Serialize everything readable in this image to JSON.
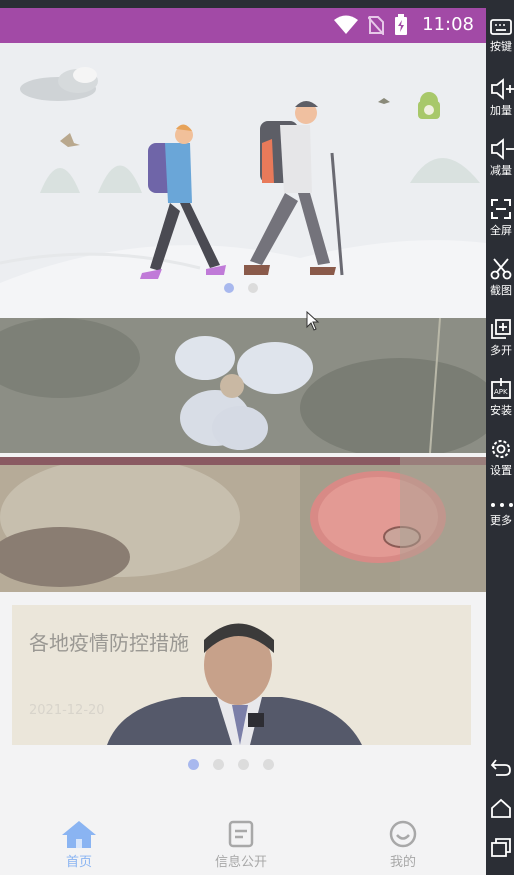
{
  "status_bar": {
    "time": "11:08",
    "color": "#a24aa6"
  },
  "hero_carousel": {
    "pages": 2,
    "active_index": 0
  },
  "news_card": {
    "title": "各地疫情防控措施",
    "date": "2021-12-20"
  },
  "news_carousel": {
    "pages": 4,
    "active_index": 0
  },
  "tabs": [
    {
      "label": "首页",
      "icon": "home-icon",
      "active": true
    },
    {
      "label": "信息公开",
      "icon": "document-icon",
      "active": false
    },
    {
      "label": "我的",
      "icon": "smiley-icon",
      "active": false
    }
  ],
  "sidebar": {
    "items": [
      {
        "label": "按键",
        "icon": "keyboard-icon"
      },
      {
        "label": "加量",
        "icon": "volume-up-icon"
      },
      {
        "label": "减量",
        "icon": "volume-down-icon"
      },
      {
        "label": "全屏",
        "icon": "fullscreen-icon"
      },
      {
        "label": "截图",
        "icon": "scissors-icon"
      },
      {
        "label": "多开",
        "icon": "multi-open-icon"
      },
      {
        "label": "安装",
        "icon": "apk-install-icon"
      },
      {
        "label": "设置",
        "icon": "gear-icon"
      },
      {
        "label": "更多",
        "icon": "more-dots-icon"
      }
    ],
    "nav": [
      "back-icon",
      "home-nav-icon",
      "recents-icon"
    ]
  }
}
